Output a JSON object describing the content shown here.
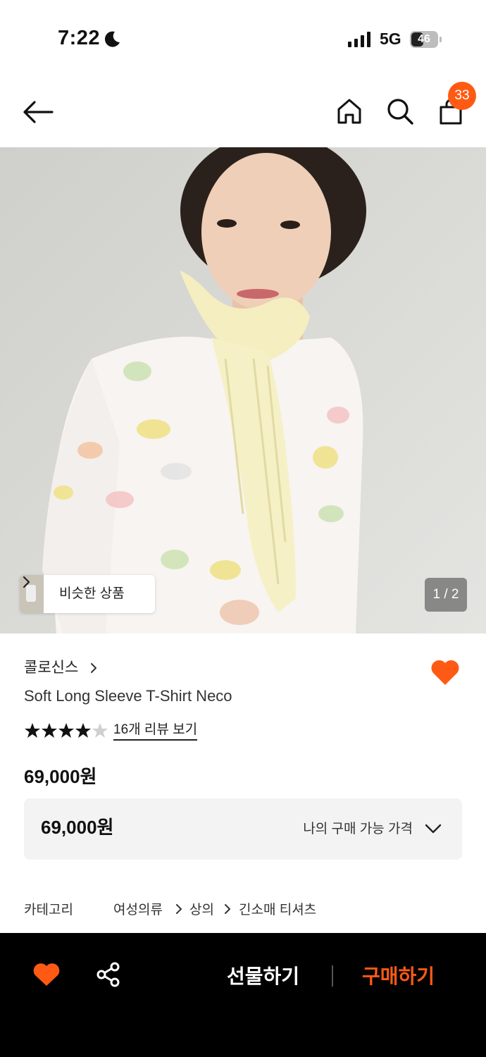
{
  "status_bar": {
    "time": "7:22",
    "network": "5G",
    "battery_level": "46"
  },
  "header": {
    "cart_count": "33"
  },
  "hero": {
    "similar_label": "비슷한 상품",
    "page_indicator": "1 / 2"
  },
  "product": {
    "brand": "콜로신스",
    "name": "Soft Long Sleeve T-Shirt Neco",
    "rating": 4.5,
    "review_link": "16개 리뷰 보기",
    "price": "69,000원"
  },
  "price_box": {
    "price": "69,000원",
    "label": "나의 구매 가능 가격"
  },
  "category": {
    "label": "카테고리",
    "path": [
      "여성의류",
      "상의",
      "긴소매 티셔츠"
    ]
  },
  "bottom_bar": {
    "gift_label": "선물하기",
    "buy_label": "구매하기"
  },
  "colors": {
    "accent": "#ff5a14",
    "bottom_bar_bg": "#000000"
  }
}
